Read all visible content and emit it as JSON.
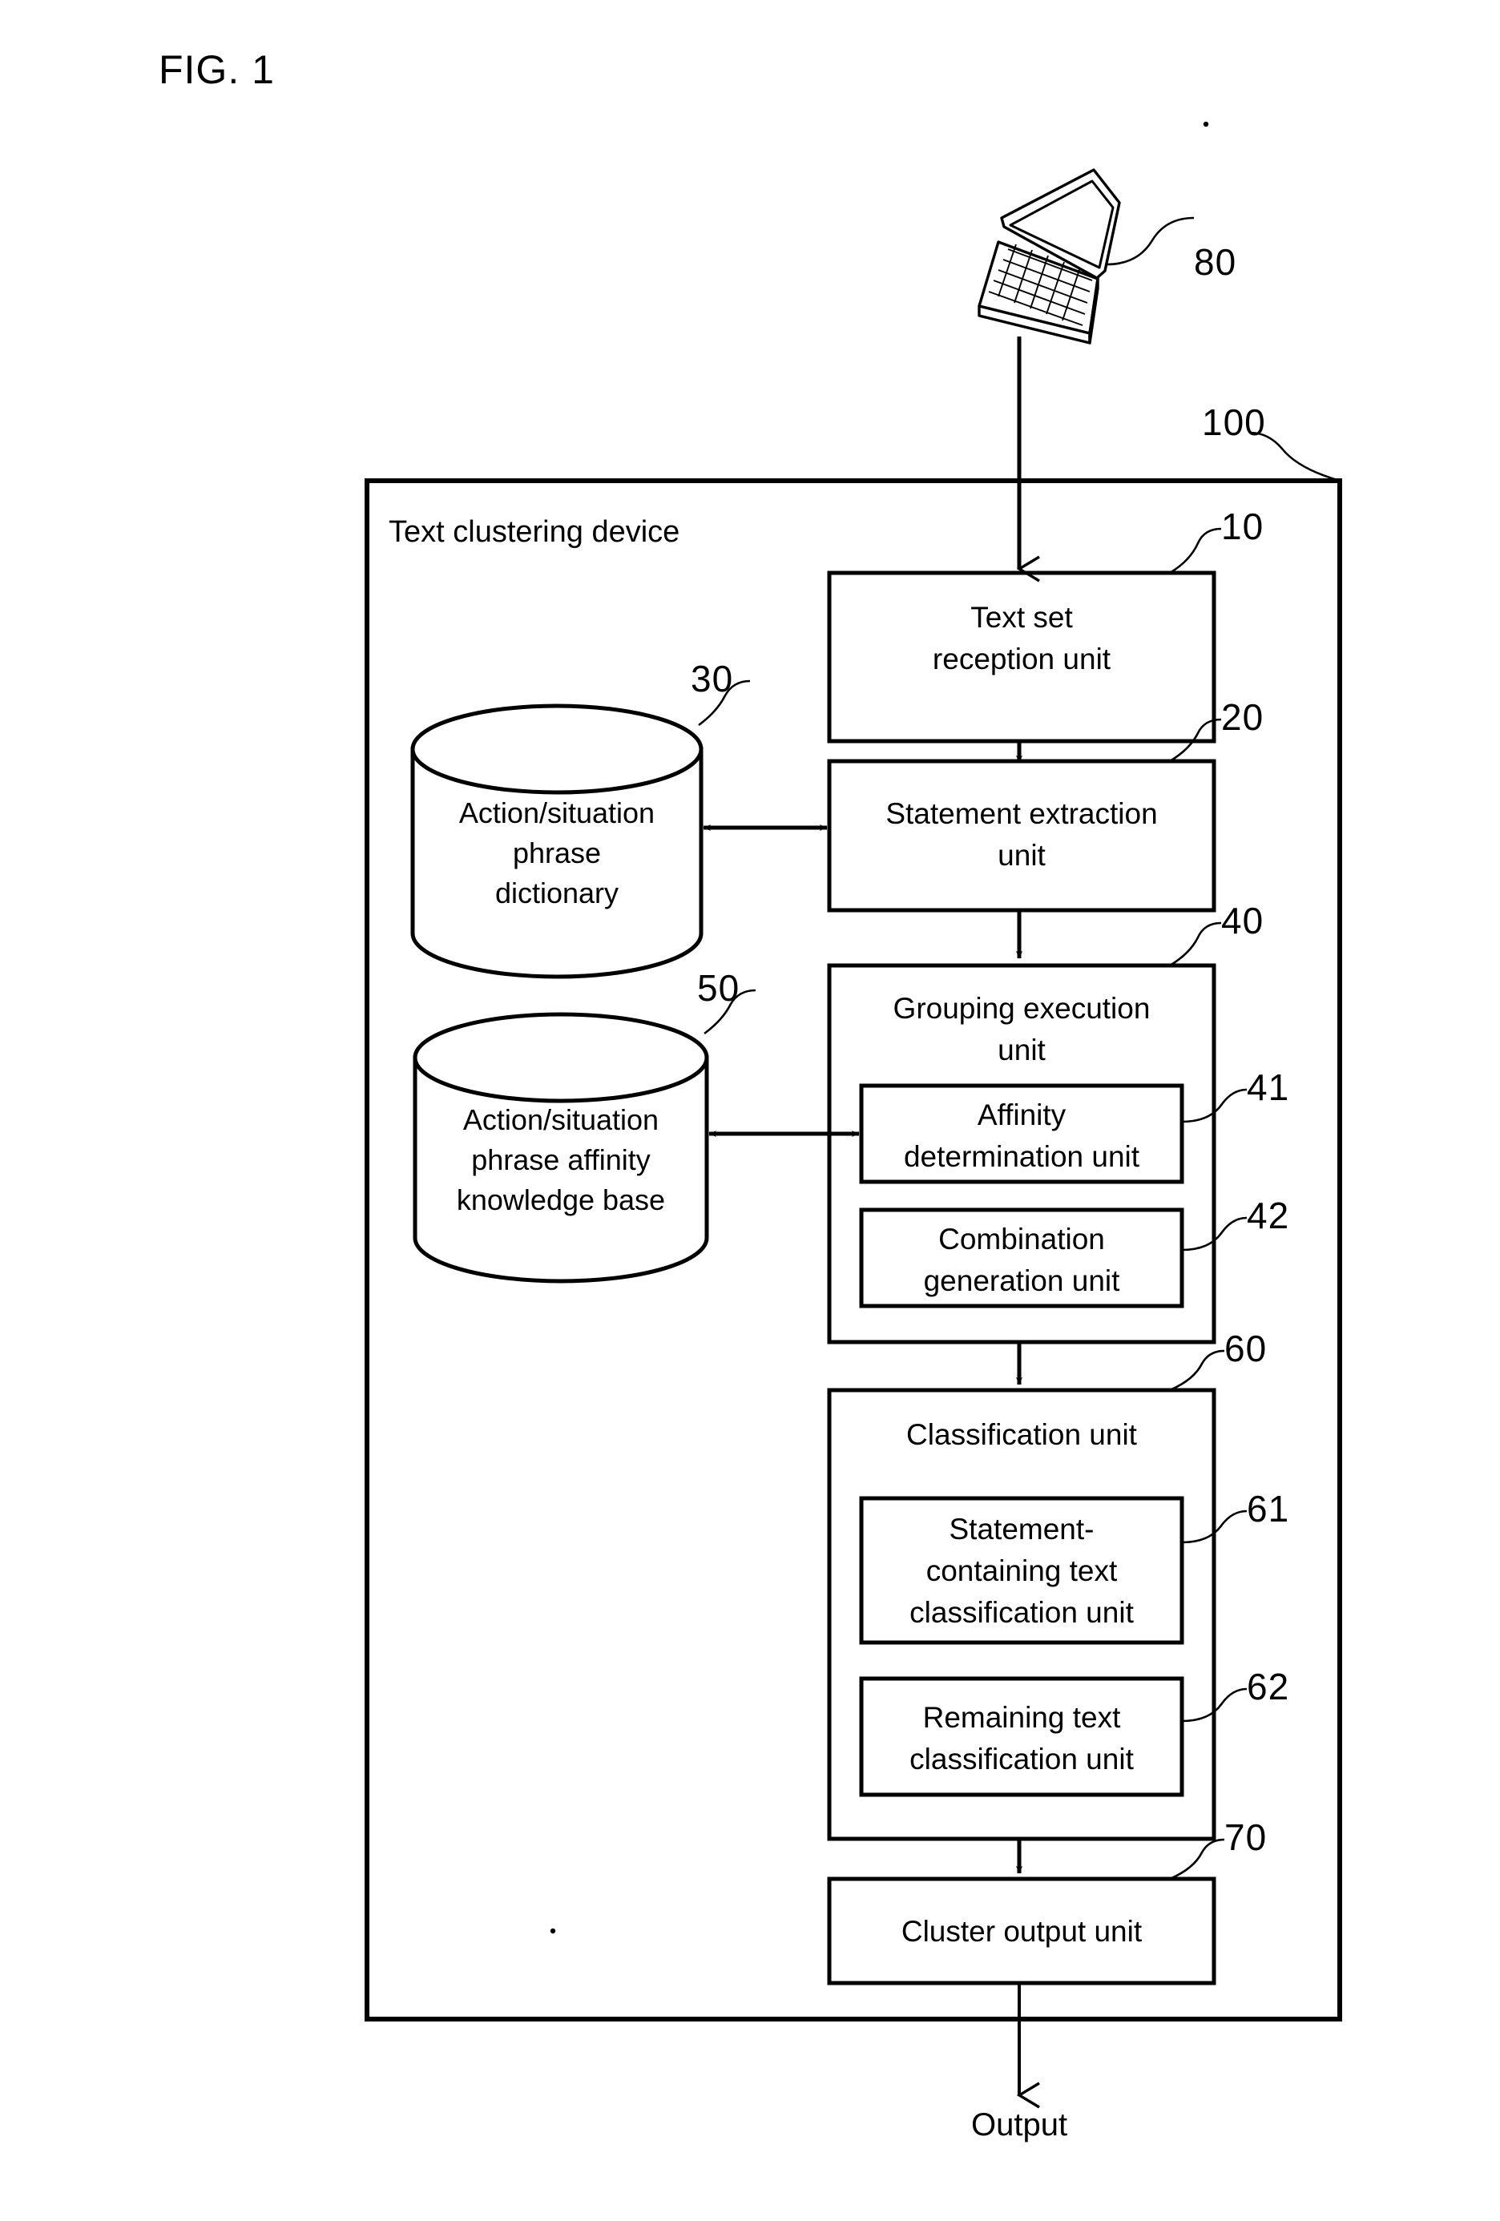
{
  "figure": {
    "title": "FIG. 1"
  },
  "diagram": {
    "device_title": "Text clustering device",
    "output_label": "Output",
    "terminal_icon": "laptop-icon",
    "boxes": [
      {
        "id": "text-set-reception-unit",
        "label": "Text set\nreception unit",
        "ref": "10"
      },
      {
        "id": "statement-extraction-unit",
        "label": "Statement extraction\nunit",
        "ref": "20"
      },
      {
        "id": "grouping-execution-unit",
        "label": "Grouping execution\nunit",
        "ref": "40"
      },
      {
        "id": "affinity-determination-unit",
        "label": "Affinity\ndetermination unit",
        "ref": "41"
      },
      {
        "id": "combination-generation-unit",
        "label": "Combination\ngeneration unit",
        "ref": "42"
      },
      {
        "id": "classification-unit",
        "label": "Classification unit",
        "ref": "60"
      },
      {
        "id": "statement-containing-text-classification-unit",
        "label": "Statement-\ncontaining text\nclassification unit",
        "ref": "61"
      },
      {
        "id": "remaining-text-classification-unit",
        "label": "Remaining text\nclassification unit",
        "ref": "62"
      },
      {
        "id": "cluster-output-unit",
        "label": "Cluster output unit",
        "ref": "70"
      }
    ],
    "datastores": [
      {
        "id": "action-situation-phrase-dictionary",
        "label": "Action/situation\nphrase\ndictionary",
        "ref": "30"
      },
      {
        "id": "action-situation-phrase-affinity-knowledge-base",
        "label": "Action/situation\nphrase affinity\nknowledge base",
        "ref": "50"
      }
    ],
    "refs": {
      "terminal": "80",
      "device": "100",
      "text_set_reception_unit": "10",
      "statement_extraction_unit": "20",
      "phrase_dictionary": "30",
      "grouping_execution_unit": "40",
      "affinity_determination_unit": "41",
      "combination_generation_unit": "42",
      "affinity_knowledge_base": "50",
      "classification_unit": "60",
      "statement_containing_text_classification_unit": "61",
      "remaining_text_classification_unit": "62",
      "cluster_output_unit": "70"
    }
  }
}
